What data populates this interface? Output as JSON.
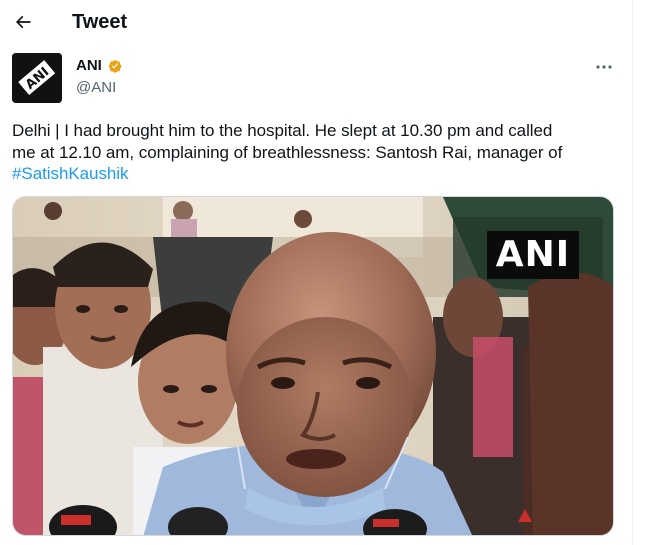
{
  "header": {
    "title": "Tweet"
  },
  "author": {
    "name": "ANI",
    "handle": "@ANI",
    "verified": true,
    "avatar_logo": "ANI"
  },
  "tweet": {
    "text_line1": "Delhi | I had brought him to the hospital. He slept at 10.30 pm and called",
    "text_line2": "me at 12.10 am, complaining of breathlessness: Santosh Rai, manager of",
    "hashtag": "#SatishKaushik"
  },
  "media": {
    "watermark": "ANI"
  },
  "icons": {
    "back": "arrow-left-icon",
    "verified": "verified-badge-icon",
    "more": "more-options-icon"
  },
  "colors": {
    "text": "#0f1419",
    "secondary": "#536471",
    "link": "#1d9bf0",
    "verified_gold": "#e8a317"
  }
}
